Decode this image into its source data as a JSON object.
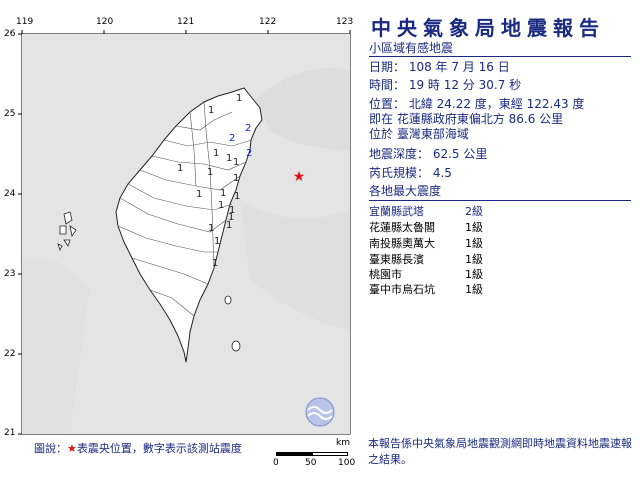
{
  "title": "中央氣象局地震報告",
  "subtitle": "小區域有感地震",
  "date": "日期： 108 年 7 月 16 日",
  "time": "時間： 19 時 12 分 30.7 秒",
  "location": {
    "line1": "位置： 北緯 24.22 度，東經 122.43 度",
    "line2": "即在 花蓮縣政府東偏北方 86.6 公里",
    "line3": "位於 臺灣東部海域"
  },
  "depth": "地震深度： 62.5 公里",
  "magnitude": "芮氏規模： 4.5",
  "intensity_header": "各地最大震度",
  "intensity_rows": [
    {
      "station": "宜蘭縣武塔",
      "level": "2級"
    },
    {
      "station": "花蓮縣太魯閣",
      "level": "1級"
    },
    {
      "station": "南投縣奧萬大",
      "level": "1級"
    },
    {
      "station": "臺東縣長濱",
      "level": "1級"
    },
    {
      "station": "桃園市",
      "level": "1級"
    },
    {
      "station": "臺中市烏石坑",
      "level": "1級"
    }
  ],
  "map": {
    "lon_ticks": [
      "119",
      "120",
      "121",
      "122",
      "123"
    ],
    "lat_ticks": [
      "26",
      "25",
      "24",
      "23",
      "22",
      "21"
    ],
    "epicenter_symbol": "★",
    "station_marks": [
      {
        "v": "1"
      },
      {
        "v": "1"
      },
      {
        "v": "2"
      },
      {
        "v": "2"
      },
      {
        "v": "1"
      },
      {
        "v": "1"
      },
      {
        "v": "1"
      },
      {
        "v": "1"
      },
      {
        "v": "1"
      },
      {
        "v": "1"
      },
      {
        "v": "1"
      },
      {
        "v": "1"
      },
      {
        "v": "1"
      },
      {
        "v": "1"
      },
      {
        "v": "1"
      },
      {
        "v": "1"
      },
      {
        "v": "1"
      },
      {
        "v": "1"
      },
      {
        "v": "1"
      },
      {
        "v": "1"
      },
      {
        "v": "2"
      }
    ]
  },
  "legend": {
    "prefix": "圖說：",
    "star": "★",
    "text": "表震央位置，數字表示該測站震度"
  },
  "scale": {
    "unit": "km",
    "labels": [
      "0",
      "50",
      "100"
    ]
  },
  "note": "本報告係中央氣象局地震觀測網即時地震資料地震速報之結果。",
  "colors": {
    "sea": "#e4e4e4",
    "land": "#ffffff",
    "text": "#1a2a80",
    "epicenter": "#e01010"
  }
}
